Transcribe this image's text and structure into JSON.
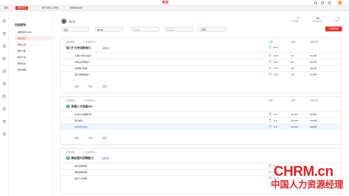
{
  "header": {
    "logo": "用友",
    "tab1": "首页",
    "tab2": "我的目标",
    "tab3": "部门负责人工作台",
    "tab4": "我的目标设置",
    "stat1_value": "0",
    "stat1_label": "目标总数",
    "stat2_value": "0%",
    "stat2_label": "目标完成率",
    "stat3_value": "2",
    "stat3_label": "待办"
  },
  "nav": {
    "title": "目标规划",
    "items": [
      "战略目标(Goal)",
      "我的目标",
      "我的上级",
      "我的下级",
      "我的下级",
      "我的关注",
      "目标地图"
    ]
  },
  "main": {
    "user": "程兴达",
    "filters": {
      "f1": "全部",
      "f2": "进行中",
      "f3": "请选择",
      "f4": "请选择",
      "f5": "请选择",
      "search": "搜索"
    },
    "new_button": "+ 新建目标"
  },
  "columns": {
    "c1": "进度",
    "c2": "权重",
    "c3": "周期",
    "c4": "结束时间"
  },
  "sections": [
    {
      "meta": "目标类型",
      "meta2": "人力资源中心",
      "title": "扩大市场影响力",
      "tag": "进行中",
      "rows": [
        {
          "name": "大客户影响力提升",
          "p": "50 %",
          "w": "0%",
          "y": "2022年"
        },
        {
          "name": "市场占有率提升",
          "p": "50 %",
          "w": "0%",
          "y": "2022年"
        },
        {
          "name": "新增客户数量",
          "p": "50 %",
          "w": "0%",
          "y": "2022年"
        },
        {
          "name": "客户满意度提升",
          "p": "50 %",
          "w": "0%",
          "y": "2022年"
        }
      ],
      "actions": [
        "编辑",
        "新增",
        "删除"
      ]
    },
    {
      "meta": "目标类型",
      "meta2": "人力资源中心",
      "title": "高潜人才发展IDP",
      "tag": "",
      "rows": [
        {
          "name": "高潜人才发展计划",
          "p": "0 %",
          "w": "33.33%",
          "y": "2022年"
        },
        {
          "name": "能力提升",
          "p": "0 %",
          "w": "33.33%",
          "y": "2022年"
        },
        {
          "name": "绩效目标完成",
          "p": "0 %",
          "w": "33.34%",
          "y": "2022年"
        }
      ],
      "actions": [
        "编辑",
        "新增",
        "删除"
      ]
    },
    {
      "meta": "目标类型",
      "meta2": "人力资源中心",
      "title": "降低提升招聘能力",
      "tag": "进行中",
      "rows": [
        {
          "name": "提升招聘效率",
          "p": "61 %",
          "w": "",
          "y": "2022年"
        },
        {
          "name": "降低招聘成本",
          "p": "61 %",
          "w": "",
          "y": "2022年"
        },
        {
          "name": "提升人才质量",
          "p": "61 %",
          "w": "",
          "y": "2022年"
        }
      ],
      "actions": []
    }
  ],
  "watermark": {
    "brand": "CHRM.cn",
    "slogan": "中国人力资源经理"
  }
}
